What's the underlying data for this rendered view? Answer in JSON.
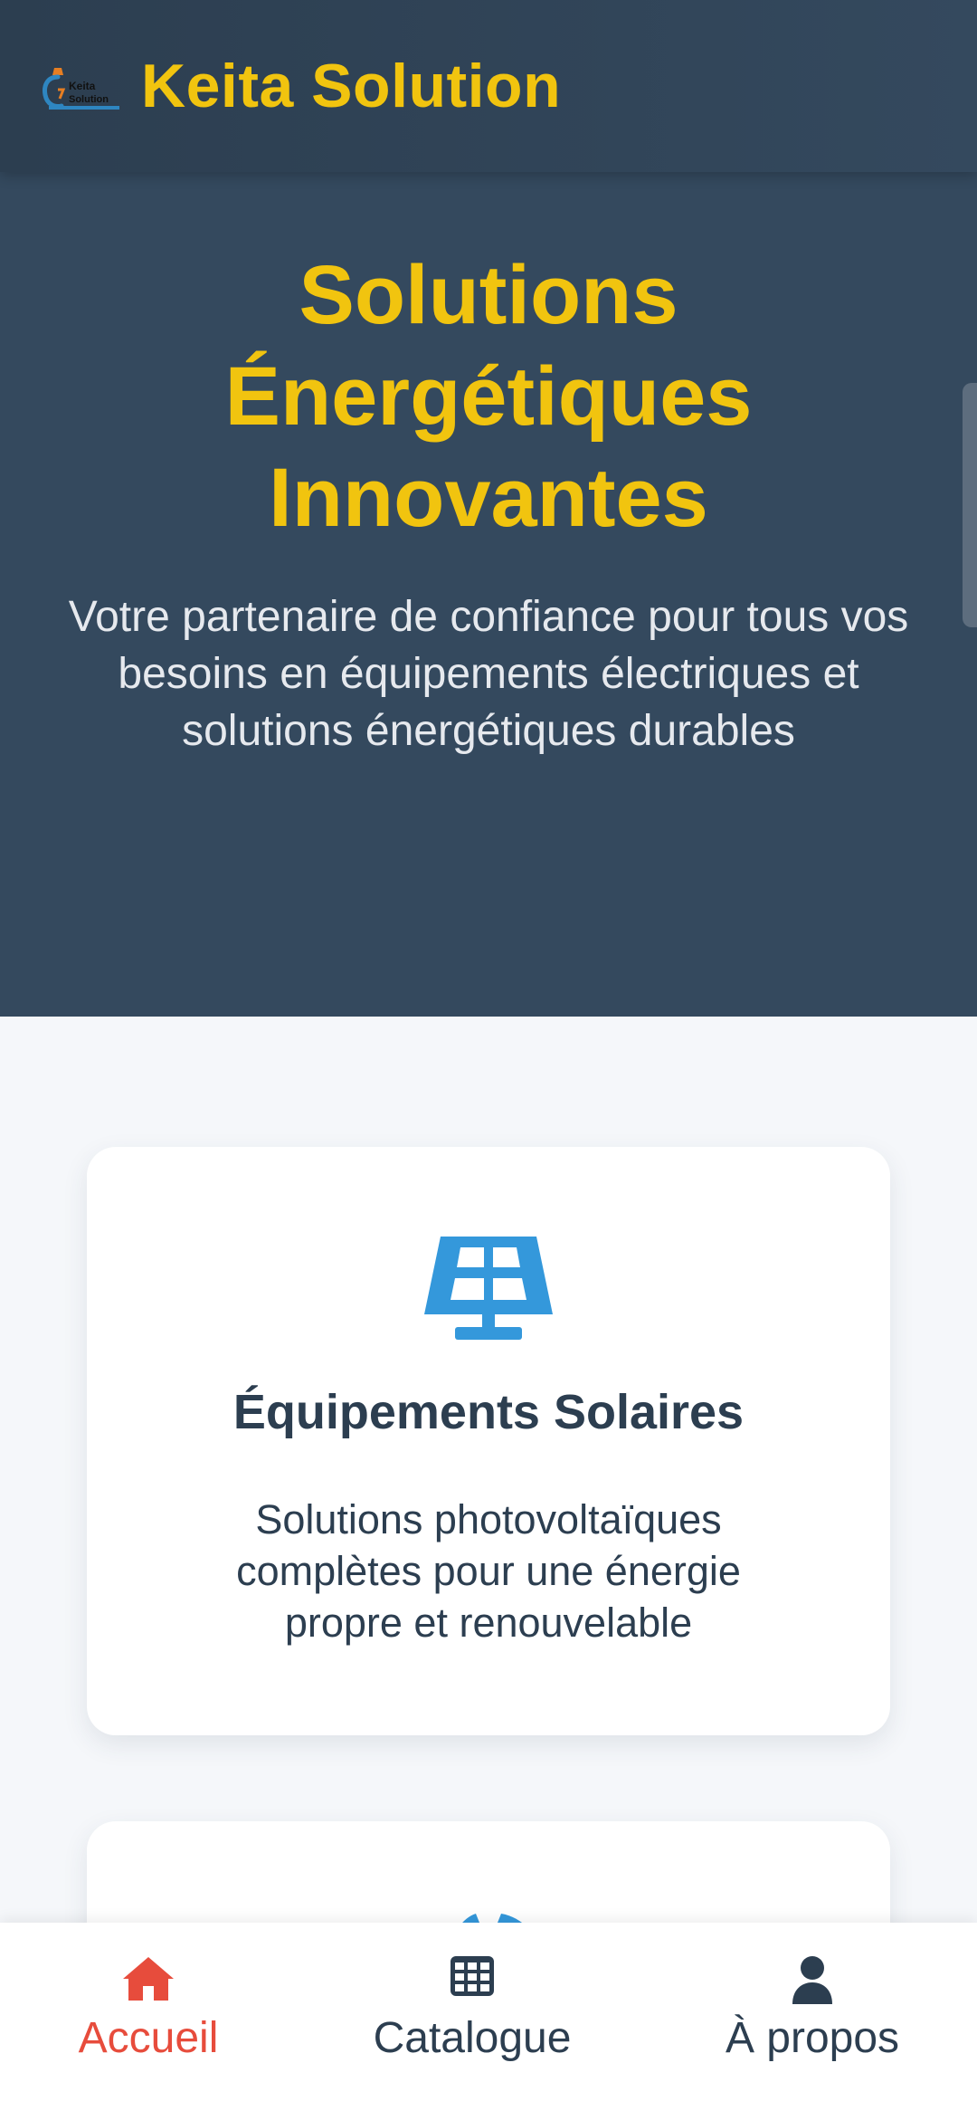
{
  "header": {
    "brand": "Keita Solution",
    "logo_text_line1": "Keita",
    "logo_text_line2": "Solution"
  },
  "hero": {
    "title": "Solutions Énergétiques Innovantes",
    "subtitle": "Votre partenaire de confiance pour tous vos besoins en équipements électriques et solutions énergétiques durables"
  },
  "features": [
    {
      "icon": "solar-panel-icon",
      "title": "Équipements Solaires",
      "description": "Solutions photovoltaïques complètes pour une énergie propre et renouvelable"
    },
    {
      "icon": "plug-icon"
    }
  ],
  "nav": {
    "items": [
      {
        "label": "Accueil",
        "icon": "home-icon",
        "active": true
      },
      {
        "label": "Catalogue",
        "icon": "grid-icon",
        "active": false
      },
      {
        "label": "À propos",
        "icon": "user-icon",
        "active": false
      }
    ]
  },
  "colors": {
    "header_bg": "#2c3e50",
    "accent_yellow": "#f1c40f",
    "active_red": "#e74c3c",
    "icon_blue": "#3498db",
    "text_dark": "#2c3e50"
  }
}
